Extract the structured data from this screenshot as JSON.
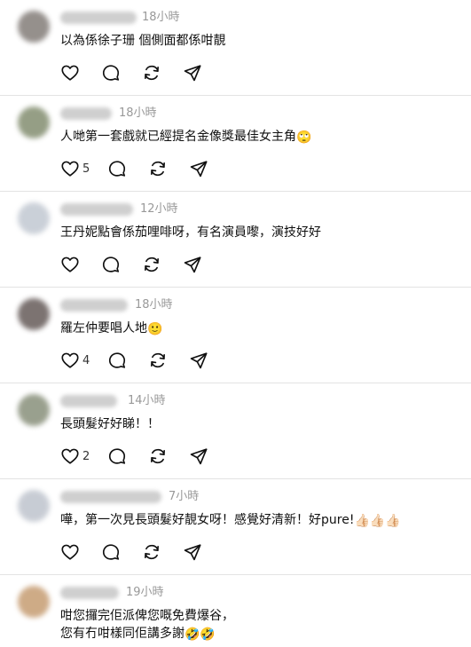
{
  "posts": [
    {
      "timestamp": "18小時",
      "text": "以為係徐子珊 個側面都係咁靚",
      "emoji": "",
      "likes": "",
      "avatar_color": "#8a8480"
    },
    {
      "timestamp": "18小時",
      "text": "人哋第一套戲就已經提名金像獎最佳女主角",
      "emoji": "🙄",
      "likes": "5",
      "avatar_color": "#8a9478"
    },
    {
      "timestamp": "12小時",
      "text": "王丹妮點會係茄哩啡呀，有名演員嚟，演技好好",
      "emoji": "",
      "likes": "",
      "avatar_color": "#c5cbd4"
    },
    {
      "timestamp": "18小時",
      "text": "羅左仲要唱人地",
      "emoji": "🙂",
      "likes": "4",
      "avatar_color": "#6e6462"
    },
    {
      "timestamp": "14小時",
      "text": "長頭髮好好睇！！",
      "emoji": "",
      "likes": "2",
      "avatar_color": "#8f9682"
    },
    {
      "timestamp": "7小時",
      "text": "嘩，第一次見長頭髮好靚女呀！感覺好清新！好pure!",
      "emoji": "👍🏻👍🏻👍🏻",
      "likes": "",
      "avatar_color": "#c2c7d0"
    },
    {
      "timestamp": "19小時",
      "text": "咁您攞完佢派俾您嘅免費爆谷，",
      "text2": "您有冇咁樣同佢講多謝",
      "emoji": "🤣🤣",
      "likes": "",
      "avatar_color": "#c9a27a"
    }
  ],
  "icons": {
    "like": "heart-icon",
    "comment": "comment-icon",
    "repost": "repost-icon",
    "share": "share-icon"
  }
}
